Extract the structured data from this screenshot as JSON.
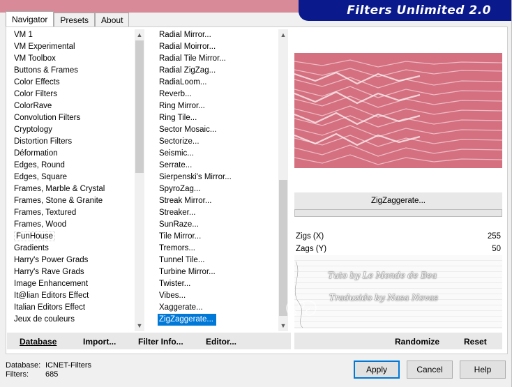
{
  "window": {
    "title": "Filters Unlimited 2.0"
  },
  "tabs": [
    {
      "label": "Navigator",
      "active": true
    },
    {
      "label": "Presets",
      "active": false
    },
    {
      "label": "About",
      "active": false
    }
  ],
  "categories": [
    "VM 1",
    "VM Experimental",
    "VM Toolbox",
    "Buttons & Frames",
    "Color Effects",
    "Color Filters",
    "ColorRave",
    "Convolution Filters",
    "Cryptology",
    "Distortion Filters",
    "Déformation",
    "Edges, Round",
    "Edges, Square",
    "Frames, Marble & Crystal",
    "Frames, Stone & Granite",
    "Frames, Textured",
    "Frames, Wood",
    "FunHouse",
    "Gradients",
    "Harry's Power Grads",
    "Harry's Rave Grads",
    "Image Enhancement",
    "It@lian Editors Effect",
    "Italian Editors Effect",
    "Jeux de couleurs"
  ],
  "selected_category": "FunHouse",
  "filters": [
    "Radial Mirror...",
    "Radial Moirror...",
    "Radial Tile Mirror...",
    "Radial ZigZag...",
    "RadiaLoom...",
    "Reverb...",
    "Ring Mirror...",
    "Ring Tile...",
    "Sector Mosaic...",
    "Sectorize...",
    "Seismic...",
    "Serrate...",
    "Sierpenski's Mirror...",
    "SpyroZag...",
    "Streak Mirror...",
    "Streaker...",
    "SunRaze...",
    "Tile Mirror...",
    "Tremors...",
    "Tunnel Tile...",
    "Turbine Mirror...",
    "Twister...",
    "Vibes...",
    "Xaggerate...",
    "ZigZaggerate..."
  ],
  "selected_filter": "ZigZaggerate...",
  "preview": {
    "filter_name": "ZigZaggerate...",
    "base_color": "#d4707f"
  },
  "params": [
    {
      "label": "Zigs (X)",
      "value": "255"
    },
    {
      "label": "Zags (Y)",
      "value": "50"
    }
  ],
  "watermark": {
    "line1": "Tuto by Le Monde de Bea",
    "line2": "Traduzido by Nasa Novas"
  },
  "bottom_left": {
    "database": "Database",
    "import": "Import...",
    "filter_info": "Filter Info...",
    "editor": "Editor..."
  },
  "bottom_right": {
    "randomize": "Randomize",
    "reset": "Reset"
  },
  "status": {
    "database_label": "Database:",
    "database_value": "ICNET-Filters",
    "filters_label": "Filters:",
    "filters_value": "685"
  },
  "buttons": {
    "apply": "Apply",
    "cancel": "Cancel",
    "help": "Help"
  }
}
